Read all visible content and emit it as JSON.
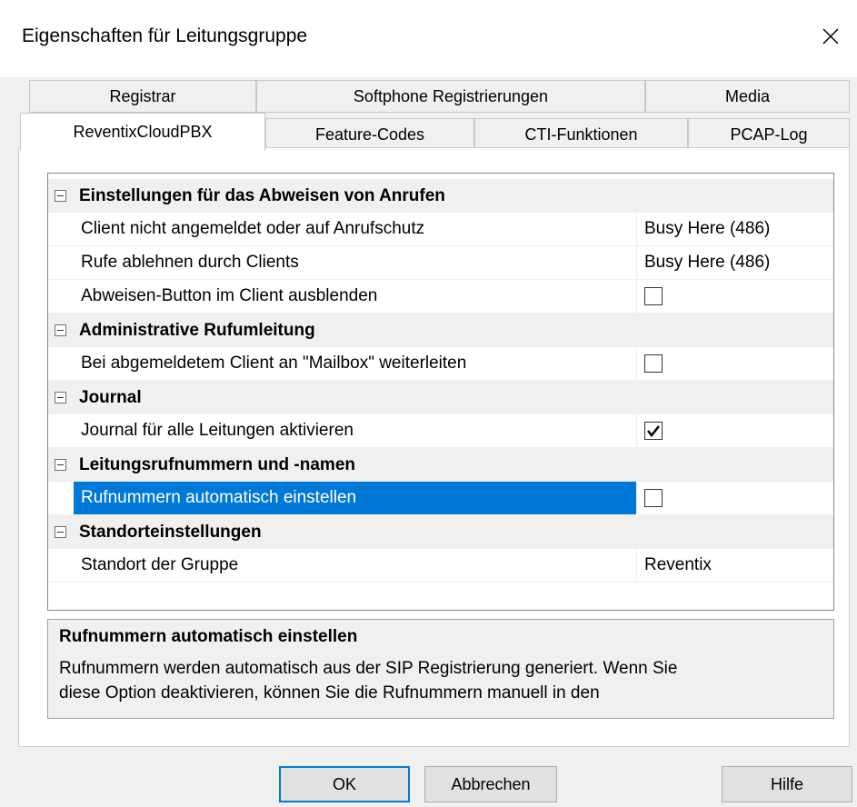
{
  "window": {
    "title": "Eigenschaften für Leitungsgruppe"
  },
  "tabs_row1": [
    "Registrar",
    "Softphone Registrierungen",
    "Media"
  ],
  "tabs_row2": [
    "ReventixCloudPBX",
    "Feature-Codes",
    "CTI-Funktionen",
    "PCAP-Log"
  ],
  "active_tab": "ReventixCloudPBX",
  "grid": {
    "cat1": {
      "label": "Einstellungen für das Abweisen von Anrufen"
    },
    "p1": {
      "name": "Client nicht angemeldet oder auf Anrufschutz",
      "value": "Busy Here (486)"
    },
    "p2": {
      "name": "Rufe ablehnen durch Clients",
      "value": "Busy Here (486)"
    },
    "p3": {
      "name": "Abweisen-Button im Client ausblenden",
      "checked": false
    },
    "cat2": {
      "label": "Administrative Rufumleitung"
    },
    "p4": {
      "name": "Bei abgemeldetem Client an \"Mailbox\" weiterleiten",
      "checked": false
    },
    "cat3": {
      "label": "Journal"
    },
    "p5": {
      "name": "Journal für alle Leitungen aktivieren",
      "checked": true
    },
    "cat4": {
      "label": "Leitungsrufnummern und -namen"
    },
    "p6": {
      "name": "Rufnummern automatisch einstellen",
      "checked": false
    },
    "cat5": {
      "label": "Standorteinstellungen"
    },
    "p7": {
      "name": "Standort der Gruppe",
      "value": "Reventix"
    }
  },
  "description": {
    "title": "Rufnummern automatisch einstellen",
    "line1": "Rufnummern werden automatisch aus der SIP Registrierung generiert. Wenn Sie",
    "line2": "diese Option deaktivieren, können Sie die Rufnummern manuell in den"
  },
  "buttons": {
    "ok": "OK",
    "cancel": "Abbrechen",
    "help": "Hilfe"
  },
  "colors": {
    "selection": "#0078d7",
    "window_bg": "#f0f0f0"
  }
}
